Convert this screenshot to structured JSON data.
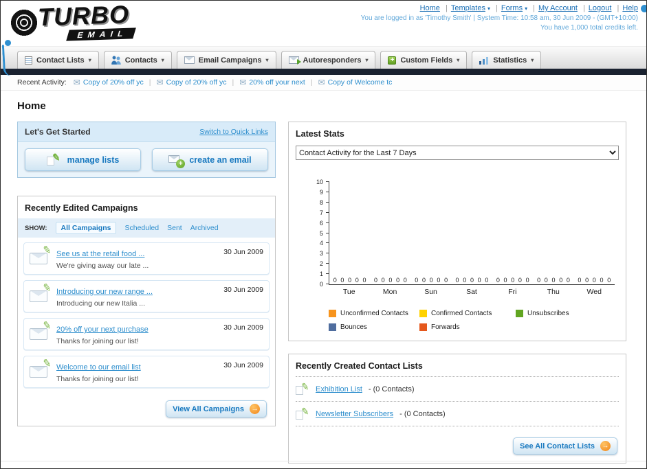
{
  "icons": {
    "chevron_down": "▾",
    "envelope": "✉",
    "pencil": "✎",
    "arrow_right": "→",
    "plus": "+"
  },
  "header": {
    "logo_title": "TURBO",
    "logo_subtitle": "EMAIL",
    "nav": [
      {
        "label": "Home"
      },
      {
        "label": "Templates"
      },
      {
        "label": "Forms"
      },
      {
        "label": "My Account"
      },
      {
        "label": "Logout"
      },
      {
        "label": "Help"
      }
    ],
    "login_info": "You are logged in as 'Timothy Smith' | System Time: 10:58 am, 30 Jun 2009 - (GMT+10:00)",
    "credits_info": "You have 1,000 total credits left."
  },
  "nav_tabs": [
    {
      "label": "Contact Lists"
    },
    {
      "label": "Contacts"
    },
    {
      "label": "Email Campaigns"
    },
    {
      "label": "Autoresponders"
    },
    {
      "label": "Custom Fields"
    },
    {
      "label": "Statistics"
    }
  ],
  "recent_activity": {
    "label": "Recent Activity:",
    "items": [
      {
        "label": "Copy of 20% off yc"
      },
      {
        "label": "Copy of 20% off yc"
      },
      {
        "label": "20% off your next"
      },
      {
        "label": "Copy of Welcome tc"
      }
    ]
  },
  "page_title": "Home",
  "get_started": {
    "title": "Let's Get Started",
    "switch_link": "Switch to Quick Links",
    "manage_lists": "manage lists",
    "create_email": "create an email"
  },
  "campaigns": {
    "title": "Recently Edited Campaigns",
    "show_label": "SHOW:",
    "tabs": [
      {
        "label": "All Campaigns"
      },
      {
        "label": "Scheduled"
      },
      {
        "label": "Sent"
      },
      {
        "label": "Archived"
      }
    ],
    "items": [
      {
        "title": "See us at the retail food ...",
        "subtitle": "We're giving away our late ...",
        "date": "30 Jun 2009"
      },
      {
        "title": "Introducing our new range ...",
        "subtitle": "Introducing our new Italia ...",
        "date": "30 Jun 2009"
      },
      {
        "title": "20% off your next purchase",
        "subtitle": "Thanks for joining our list!",
        "date": "30 Jun 2009"
      },
      {
        "title": "Welcome to our email list",
        "subtitle": "Thanks for joining our list!",
        "date": "30 Jun 2009"
      }
    ],
    "view_all": "View All Campaigns"
  },
  "stats": {
    "title": "Latest Stats",
    "dropdown_value": "Contact Activity for the Last 7 Days",
    "chart_data": {
      "type": "bar",
      "title": "Contact Activity for the Last 7 Days",
      "categories": [
        "Tue",
        "Mon",
        "Sun",
        "Sat",
        "Fri",
        "Thu",
        "Wed"
      ],
      "series": [
        {
          "name": "Unconfirmed Contacts",
          "color": "#f7941d",
          "values": [
            0,
            0,
            0,
            0,
            0,
            0,
            0
          ]
        },
        {
          "name": "Confirmed Contacts",
          "color": "#ffd200",
          "values": [
            0,
            0,
            0,
            0,
            0,
            0,
            0
          ]
        },
        {
          "name": "Unsubscribes",
          "color": "#61a521",
          "values": [
            0,
            0,
            0,
            0,
            0,
            0,
            0
          ]
        },
        {
          "name": "Bounces",
          "color": "#4f6d9e",
          "values": [
            0,
            0,
            0,
            0,
            0,
            0,
            0
          ]
        },
        {
          "name": "Forwards",
          "color": "#e5581d",
          "values": [
            0,
            0,
            0,
            0,
            0,
            0,
            0
          ]
        }
      ],
      "ylim": [
        0,
        10
      ],
      "yticks": [
        0,
        1,
        2,
        3,
        4,
        5,
        6,
        7,
        8,
        9,
        10
      ],
      "grid": false,
      "legend_position": "bottom"
    }
  },
  "contact_lists": {
    "title": "Recently Created Contact Lists",
    "items": [
      {
        "name": "Exhibition List",
        "detail": "- (0 Contacts)"
      },
      {
        "name": "Newsletter Subscribers",
        "detail": "- (0 Contacts)"
      }
    ],
    "see_all": "See All Contact Lists"
  }
}
